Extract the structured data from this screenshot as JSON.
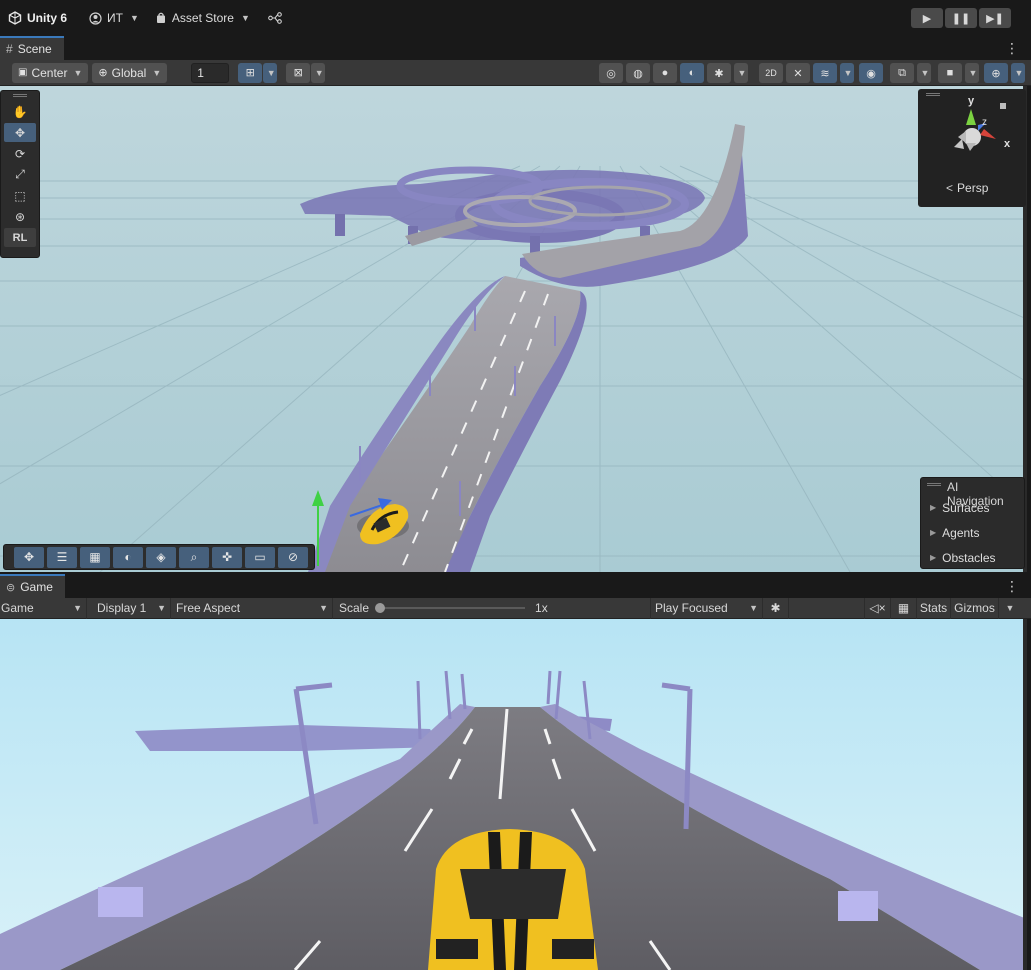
{
  "topbar": {
    "logo_label": "Unity 6",
    "account_label": "ИТ",
    "asset_store_label": "Asset Store"
  },
  "scene_panel": {
    "tab_label": "Scene",
    "pivot_label": "Center",
    "space_label": "Global",
    "snap_value": "1",
    "persp_label": "Persp",
    "axis_x": "x",
    "axis_y": "y",
    "axis_z": "z",
    "tool_rl_label": "RL",
    "nav": {
      "title": "AI Navigation",
      "items": [
        "Surfaces",
        "Agents",
        "Obstacles"
      ]
    }
  },
  "game_panel": {
    "tab_label": "Game",
    "view_select": "Game",
    "display_select": "Display 1",
    "aspect_select": "Free Aspect",
    "scale_label": "Scale",
    "scale_value": "1x",
    "play_mode_select": "Play Focused",
    "stats_label": "Stats",
    "gizmos_label": "Gizmos"
  },
  "colors": {
    "accent": "#46607c",
    "tab_highlight": "#3a79bb",
    "road_purple": "#8e8bc6",
    "car_yellow": "#f0c020"
  }
}
